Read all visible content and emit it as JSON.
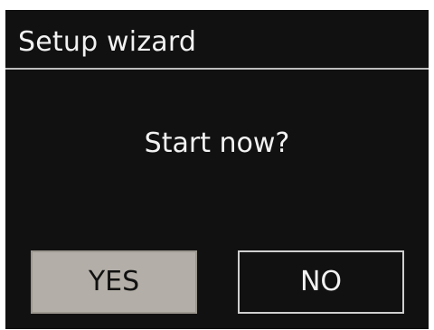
{
  "header": {
    "title": "Setup wizard"
  },
  "dialog": {
    "question": "Start now?",
    "yes_label": "YES",
    "no_label": "NO"
  },
  "colors": {
    "background": "#111111",
    "text": "#f2f2f2",
    "selected_button": "#b3aea7",
    "divider": "#bdbdbd"
  }
}
